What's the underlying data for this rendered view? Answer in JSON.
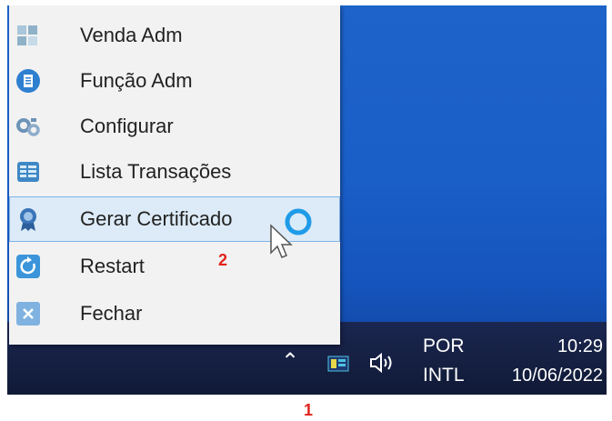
{
  "menu": {
    "items": [
      {
        "label": "Venda Adm",
        "icon": "grid-icon",
        "color": "#8fb2c9"
      },
      {
        "label": "Função Adm",
        "icon": "document-icon",
        "color": "#2f7fd0"
      },
      {
        "label": "Configurar",
        "icon": "gears-icon",
        "color": "#6c93b8"
      },
      {
        "label": "Lista Transações",
        "icon": "list-icon",
        "color": "#3f88c6"
      },
      {
        "label": "Gerar Certificado",
        "icon": "certificate-icon",
        "color": "#3a74b8"
      },
      {
        "label": "Restart",
        "icon": "restart-icon",
        "color": "#3c95da"
      },
      {
        "label": "Fechar",
        "icon": "close-icon",
        "color": "#7fb2e0"
      }
    ],
    "hovered_index": 4
  },
  "taskbar": {
    "language": "POR",
    "keyboard": "INTL",
    "time": "10:29",
    "date": "10/06/2022"
  },
  "annotations": {
    "step_one": "1",
    "step_two": "2"
  },
  "colors": {
    "desktop": "#1a5ec7",
    "taskbar": "#101a36",
    "menu_background": "#f2f2f2",
    "hover_fill": "#dcebf7",
    "annotation": "#e0241b"
  }
}
